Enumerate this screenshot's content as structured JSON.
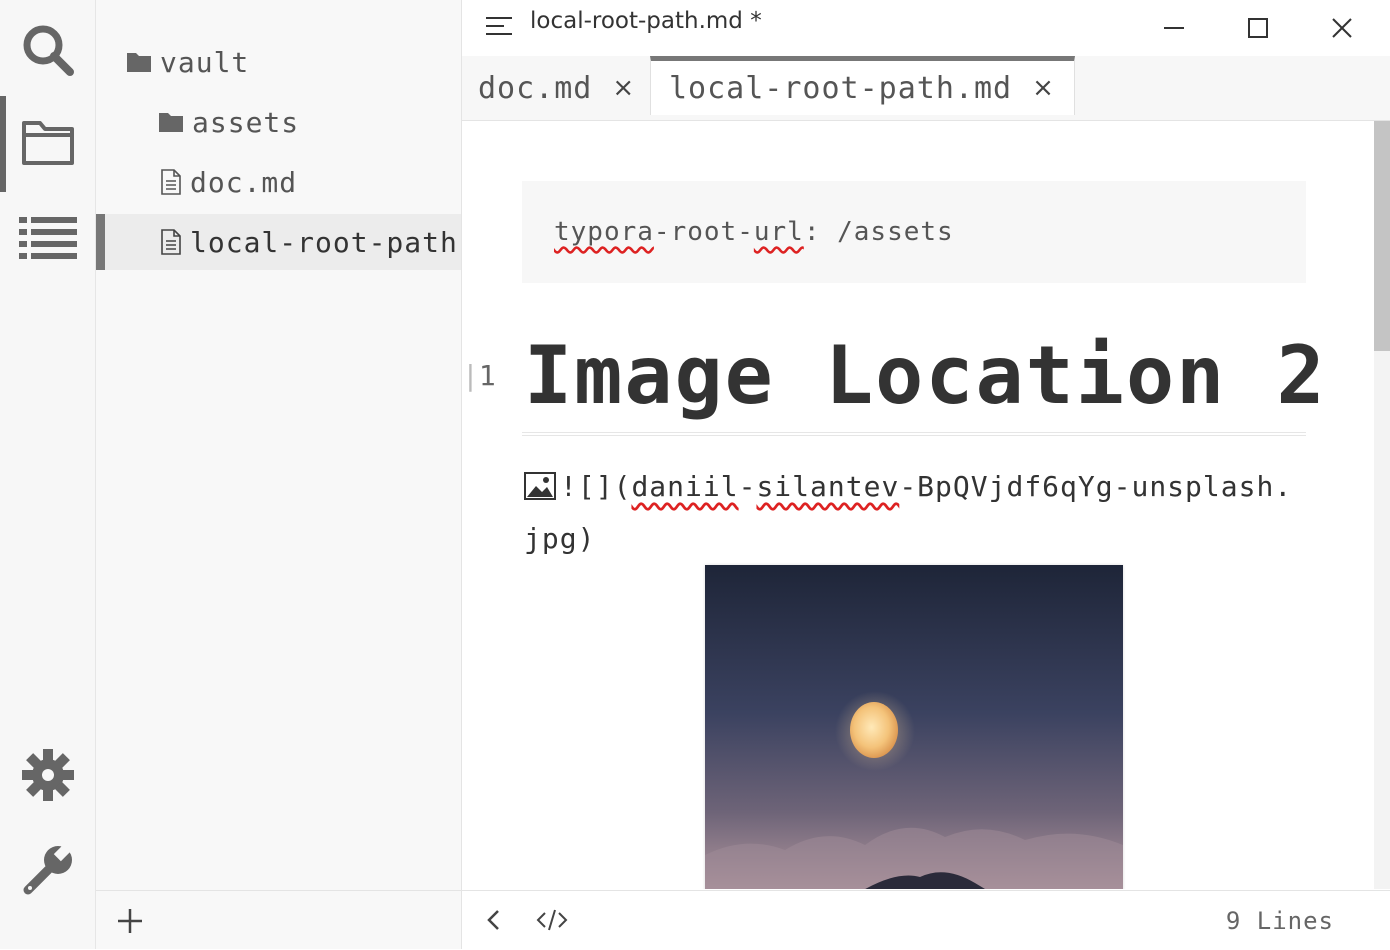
{
  "window": {
    "title": "local-root-path.md",
    "modified_marker": "*"
  },
  "activity_bar": {
    "items": [
      "search-icon",
      "folder-icon",
      "outline-icon"
    ],
    "bottom_items": [
      "gear-icon",
      "wrench-icon"
    ]
  },
  "sidebar": {
    "tree": [
      {
        "label": "vault",
        "type": "folder",
        "depth": 0
      },
      {
        "label": "assets",
        "type": "folder",
        "depth": 1
      },
      {
        "label": "doc.md",
        "type": "file",
        "depth": 1
      },
      {
        "label": "local-root-path.md",
        "type": "file",
        "depth": 1,
        "active": true
      }
    ],
    "footer_add": "+"
  },
  "tabs": [
    {
      "label": "doc.md",
      "close": "×",
      "active": false
    },
    {
      "label": "local-root-path.md",
      "close": "×",
      "active": true
    }
  ],
  "editor": {
    "frontmatter": {
      "key_part1": "typora",
      "key_part2": "-root-",
      "key_part3": "url",
      "value": ": /assets"
    },
    "gutter_number": "1",
    "heading": "Image Location 2",
    "image_markdown": {
      "prefix": "![](",
      "word1": "daniil",
      "dash1": "-",
      "word2": "silantev",
      "rest": "-BpQVjdf6qYg-unsplash.",
      "line2": "jpg)"
    }
  },
  "statusbar": {
    "lines": "9 Lines"
  },
  "colors": {
    "accent": "#777777",
    "sidebar_bg": "#f8f8f8",
    "spellcheck": "#dd2222"
  }
}
